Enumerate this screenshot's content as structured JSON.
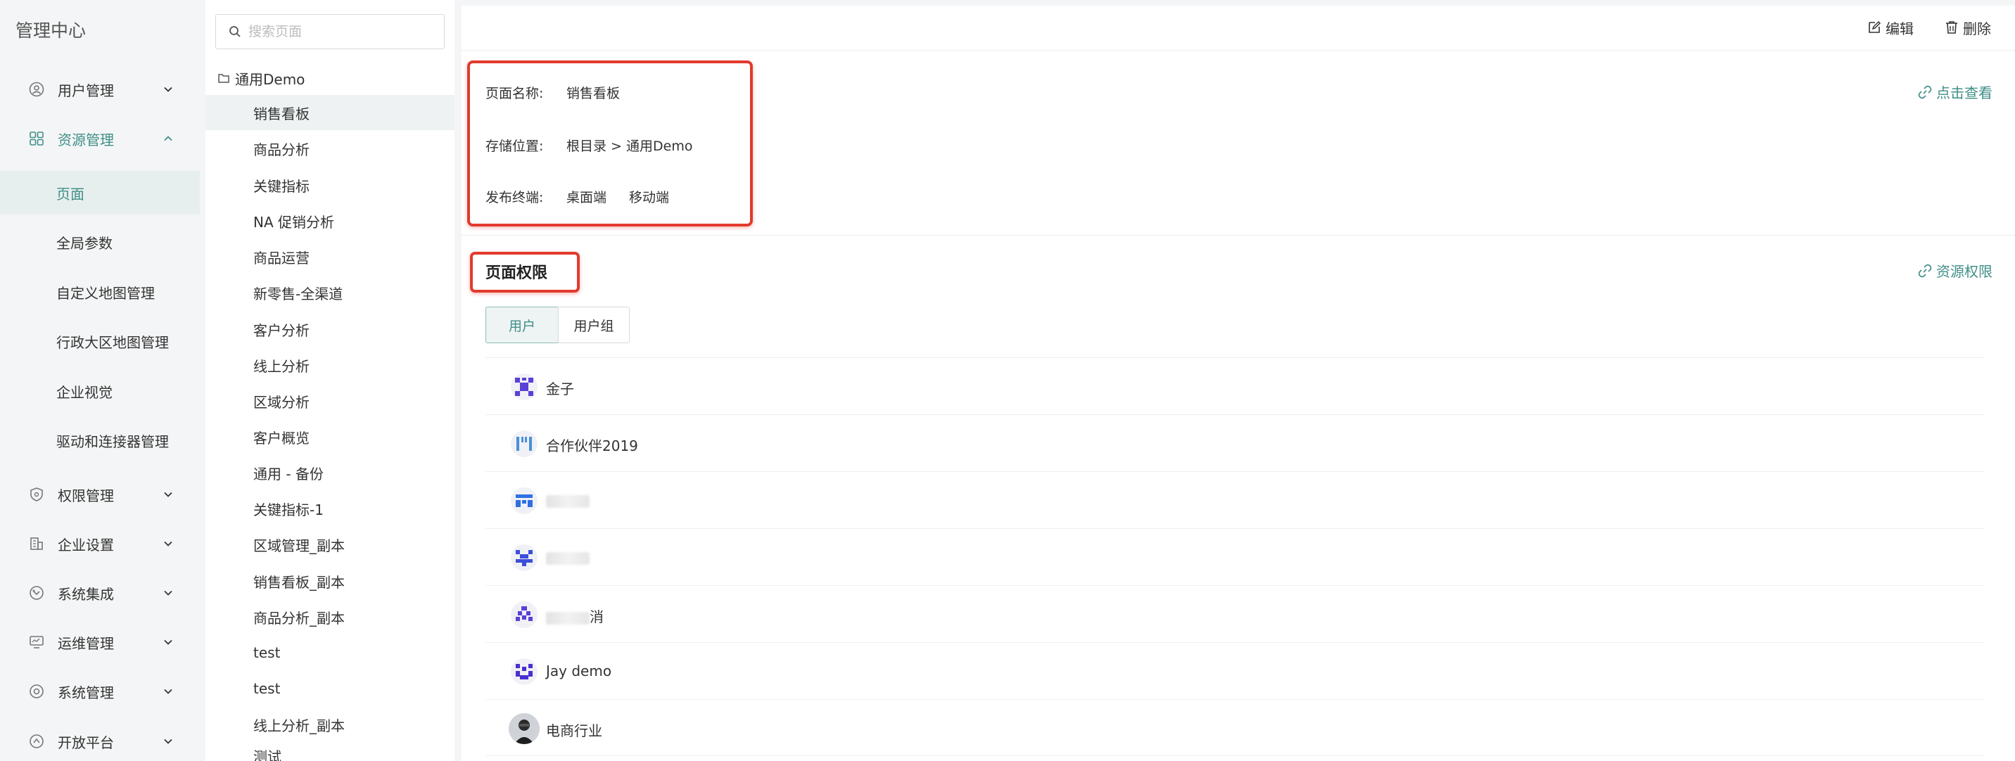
{
  "nav": {
    "title": "管理中心",
    "items": [
      {
        "label": "用户管理",
        "icon": "user-icon",
        "expanded": false
      },
      {
        "label": "资源管理",
        "icon": "grid-icon",
        "expanded": true
      },
      {
        "label": "权限管理",
        "icon": "shield-icon",
        "expanded": false
      },
      {
        "label": "企业设置",
        "icon": "building-icon",
        "expanded": false
      },
      {
        "label": "系统集成",
        "icon": "integration-icon",
        "expanded": false
      },
      {
        "label": "运维管理",
        "icon": "monitor-icon",
        "expanded": false
      },
      {
        "label": "系统管理",
        "icon": "system-icon",
        "expanded": false
      },
      {
        "label": "开放平台",
        "icon": "open-platform-icon",
        "expanded": false
      }
    ],
    "sub_items": [
      "页面",
      "全局参数",
      "自定义地图管理",
      "行政大区地图管理",
      "企业视觉",
      "驱动和连接器管理"
    ]
  },
  "list": {
    "search_placeholder": "搜索页面",
    "folder": "通用Demo",
    "pages": [
      "销售看板",
      "商品分析",
      "关键指标",
      "NA 促销分析",
      "商品运营",
      "新零售-全渠道",
      "客户分析",
      "线上分析",
      "区域分析",
      "客户概览",
      "通用 - 备份",
      "关键指标-1",
      "区域管理_副本",
      "销售看板_副本",
      "商品分析_副本",
      "test",
      "test",
      "线上分析_副本",
      "测试"
    ]
  },
  "toolbar": {
    "edit": "编辑",
    "delete": "删除"
  },
  "info": {
    "name_label": "页面名称:",
    "name_value": "销售看板",
    "location_label": "存储位置:",
    "location_value": "根目录 > 通用Demo",
    "terminal_label": "发布终端:",
    "terminal_desktop": "桌面端",
    "terminal_mobile": "移动端",
    "view_link": "点击查看"
  },
  "permissions": {
    "title": "页面权限",
    "resource_link": "资源权限",
    "tabs": [
      "用户",
      "用户组"
    ],
    "users": [
      {
        "name": "金子"
      },
      {
        "name": "合作伙伴2019"
      },
      {
        "name": ""
      },
      {
        "name": ""
      },
      {
        "name": "消"
      },
      {
        "name": "Jay demo"
      },
      {
        "name": "电商行业"
      }
    ]
  },
  "colors": {
    "accent": "#3f8f88",
    "highlight": "#e23a2e",
    "avatar_purple": "#5b3fd6",
    "avatar_blue": "#2f6fe0"
  }
}
